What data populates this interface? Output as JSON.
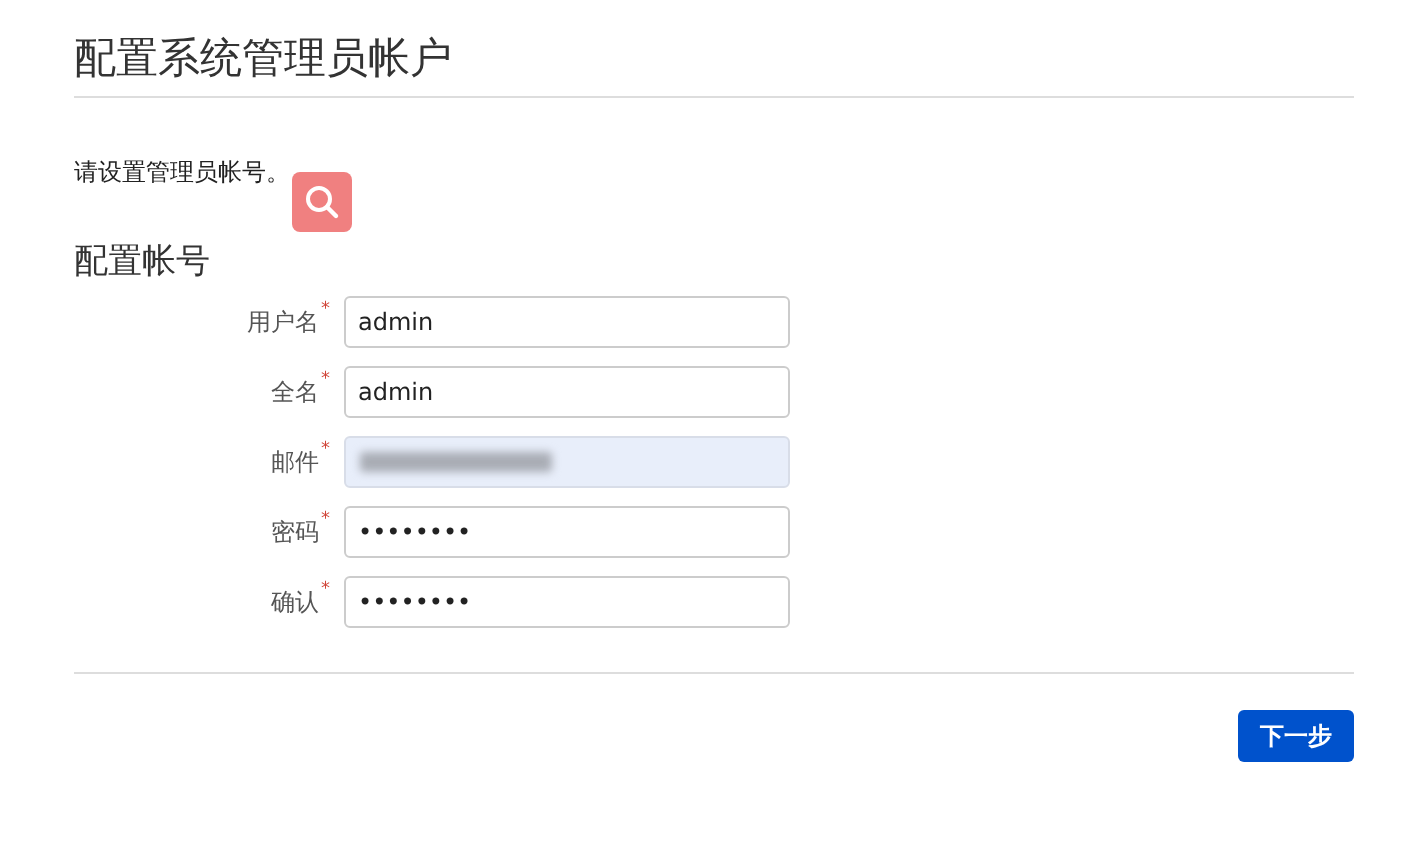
{
  "title": "配置系统管理员帐户",
  "intro": "请设置管理员帐号。",
  "section_title": "配置帐号",
  "fields": [
    {
      "label": "用户名",
      "required_mark": "*",
      "kind": "text",
      "value": "admin"
    },
    {
      "label": "全名",
      "required_mark": "*",
      "kind": "text",
      "value": "admin"
    },
    {
      "label": "邮件",
      "required_mark": "*",
      "kind": "blurred"
    },
    {
      "label": "密码",
      "required_mark": "*",
      "kind": "text",
      "value": "••••••••"
    },
    {
      "label": "确认",
      "required_mark": "*",
      "kind": "text",
      "value": "••••••••"
    }
  ],
  "next_button": "下一步"
}
